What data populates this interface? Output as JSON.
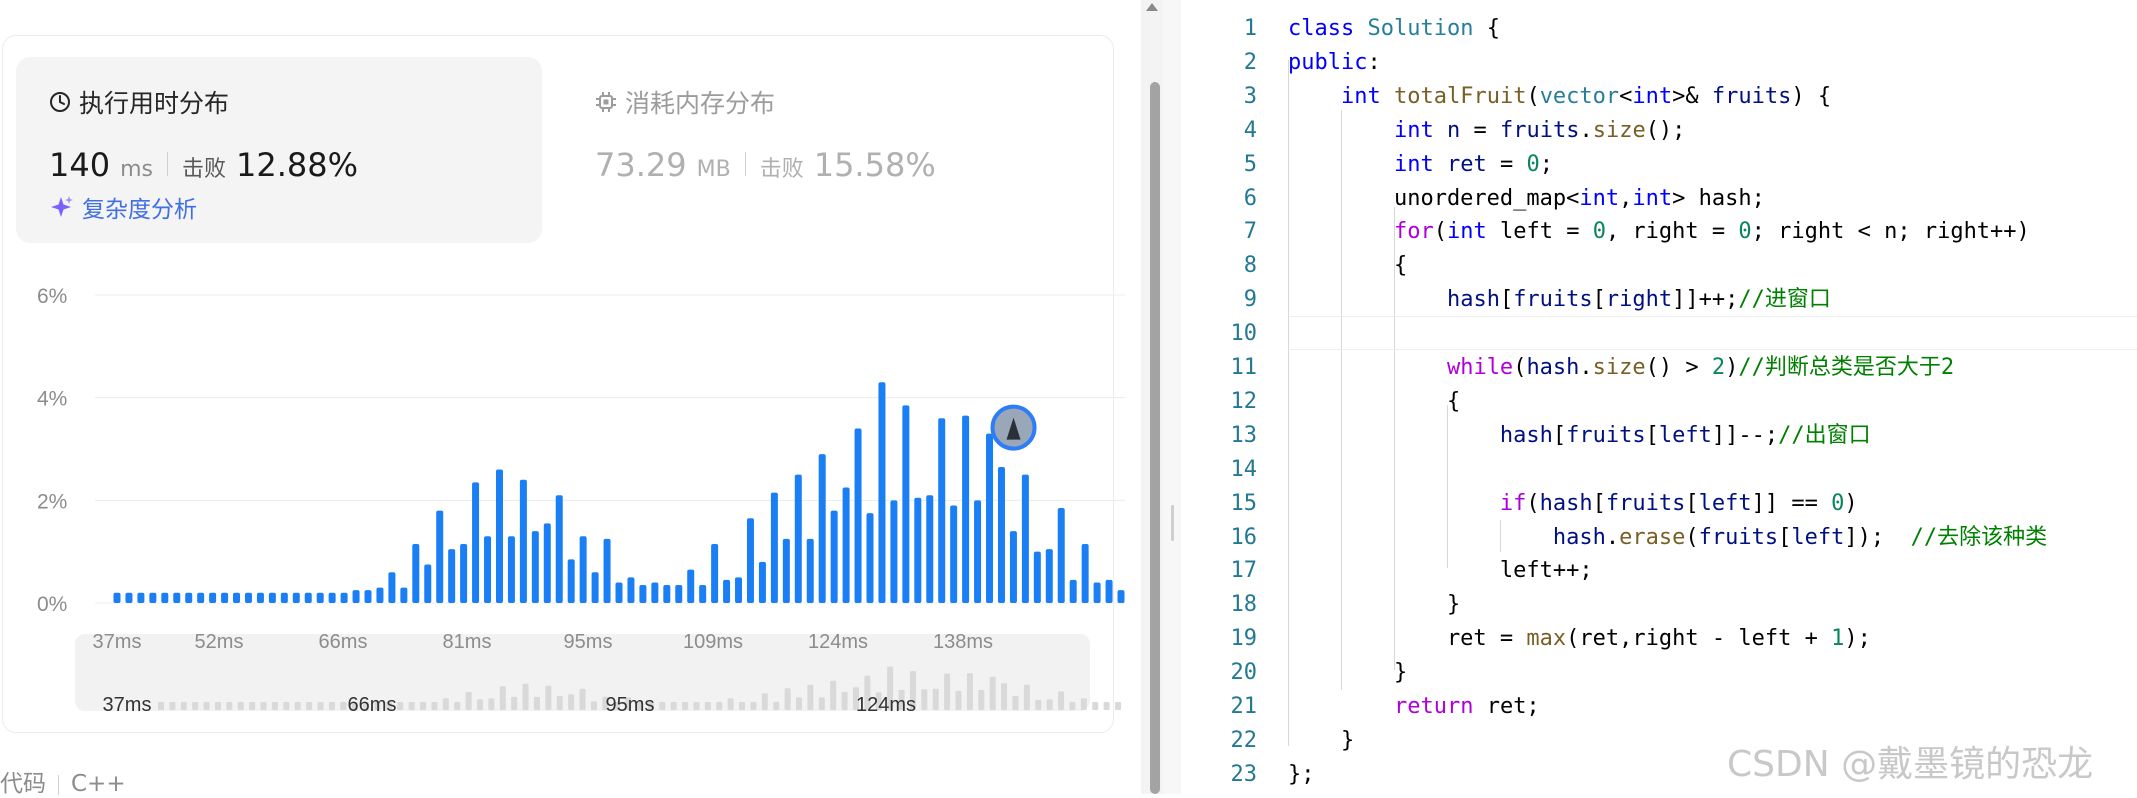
{
  "time_panel": {
    "title": "执行用时分布",
    "value": "140",
    "unit": "ms",
    "beat_label": "击败",
    "beat_value": "12.88%",
    "complexity_link": "复杂度分析"
  },
  "memory_panel": {
    "title": "消耗内存分布",
    "value": "73.29",
    "unit": "MB",
    "beat_label": "击败",
    "beat_value": "15.58%"
  },
  "chart_data": {
    "type": "bar",
    "ylabel": "",
    "y_ticks": [
      "6%",
      "4%",
      "2%",
      "0%"
    ],
    "ylim": [
      0,
      6
    ],
    "x_ticks": [
      "37ms",
      "52ms",
      "66ms",
      "81ms",
      "95ms",
      "109ms",
      "124ms",
      "138ms"
    ],
    "values": [
      0.2,
      0.2,
      0.2,
      0.2,
      0.2,
      0.2,
      0.2,
      0.2,
      0.2,
      0.2,
      0.2,
      0.2,
      0.2,
      0.2,
      0.2,
      0.2,
      0.2,
      0.2,
      0.2,
      0.2,
      0.25,
      0.25,
      0.3,
      0.6,
      0.3,
      1.15,
      0.75,
      1.8,
      1.05,
      1.15,
      2.35,
      1.3,
      2.6,
      1.3,
      2.4,
      1.4,
      1.55,
      2.1,
      0.85,
      1.3,
      0.6,
      1.25,
      0.4,
      0.5,
      0.35,
      0.4,
      0.35,
      0.35,
      0.65,
      0.35,
      1.15,
      0.45,
      0.5,
      1.65,
      0.8,
      2.15,
      1.25,
      2.5,
      1.25,
      2.9,
      1.8,
      2.25,
      3.4,
      1.75,
      4.3,
      2.0,
      3.85,
      2.05,
      2.1,
      3.6,
      1.9,
      3.65,
      2.0,
      3.3,
      2.65,
      1.4,
      2.5,
      1.0,
      1.05,
      1.85,
      0.45,
      1.15,
      0.4,
      0.45,
      0.25
    ],
    "highlight_index": 73,
    "grid": true,
    "minimap_ticks": [
      "37ms",
      "66ms",
      "95ms",
      "124ms"
    ]
  },
  "bottom": {
    "code_label": "代码",
    "language": "C++"
  },
  "code": {
    "lines": [
      [
        [
          "kw",
          "class"
        ],
        [
          "p",
          " "
        ],
        [
          "ty",
          "Solution"
        ],
        [
          "p",
          " {"
        ]
      ],
      [
        [
          "kw",
          "public"
        ],
        [
          "p",
          ":"
        ]
      ],
      [
        [
          "p",
          "    "
        ],
        [
          "kw",
          "int"
        ],
        [
          "p",
          " "
        ],
        [
          "fn",
          "totalFruit"
        ],
        [
          "p",
          "("
        ],
        [
          "ty",
          "vector"
        ],
        [
          "p",
          "<"
        ],
        [
          "kw",
          "int"
        ],
        [
          "p",
          ">& "
        ],
        [
          "var",
          "fruits"
        ],
        [
          "p",
          ") {"
        ]
      ],
      [
        [
          "p",
          "        "
        ],
        [
          "kw",
          "int"
        ],
        [
          "p",
          " "
        ],
        [
          "var",
          "n"
        ],
        [
          "p",
          " = "
        ],
        [
          "var",
          "fruits"
        ],
        [
          "p",
          "."
        ],
        [
          "fn",
          "size"
        ],
        [
          "p",
          "();"
        ]
      ],
      [
        [
          "p",
          "        "
        ],
        [
          "kw",
          "int"
        ],
        [
          "p",
          " "
        ],
        [
          "var",
          "ret"
        ],
        [
          "p",
          " = "
        ],
        [
          "num",
          "0"
        ],
        [
          "p",
          ";"
        ]
      ],
      [
        [
          "p",
          "        unordered_map<"
        ],
        [
          "kw",
          "int"
        ],
        [
          "p",
          ","
        ],
        [
          "kw",
          "int"
        ],
        [
          "p",
          "> hash;"
        ]
      ],
      [
        [
          "p",
          "        "
        ],
        [
          "ctrl",
          "for"
        ],
        [
          "p",
          "("
        ],
        [
          "kw",
          "int"
        ],
        [
          "p",
          " left = "
        ],
        [
          "num",
          "0"
        ],
        [
          "p",
          ", right = "
        ],
        [
          "num",
          "0"
        ],
        [
          "p",
          "; right < n; right++)"
        ]
      ],
      [
        [
          "p",
          "        {"
        ]
      ],
      [
        [
          "p",
          "            "
        ],
        [
          "var",
          "hash"
        ],
        [
          "p",
          "["
        ],
        [
          "var",
          "fruits"
        ],
        [
          "p",
          "["
        ],
        [
          "var",
          "right"
        ],
        [
          "p",
          "]]++;"
        ],
        [
          "cm",
          "//进窗口"
        ]
      ],
      [
        [
          "p",
          ""
        ]
      ],
      [
        [
          "p",
          "            "
        ],
        [
          "ctrl",
          "while"
        ],
        [
          "p",
          "("
        ],
        [
          "var",
          "hash"
        ],
        [
          "p",
          "."
        ],
        [
          "fn",
          "size"
        ],
        [
          "p",
          "() > "
        ],
        [
          "num",
          "2"
        ],
        [
          "p",
          ")"
        ],
        [
          "cm",
          "//判断总类是否大于2"
        ]
      ],
      [
        [
          "p",
          "            {"
        ]
      ],
      [
        [
          "p",
          "                "
        ],
        [
          "var",
          "hash"
        ],
        [
          "p",
          "["
        ],
        [
          "var",
          "fruits"
        ],
        [
          "p",
          "["
        ],
        [
          "var",
          "left"
        ],
        [
          "p",
          "]]--;"
        ],
        [
          "cm",
          "//出窗口"
        ]
      ],
      [
        [
          "p",
          ""
        ]
      ],
      [
        [
          "p",
          "                "
        ],
        [
          "ctrl",
          "if"
        ],
        [
          "p",
          "("
        ],
        [
          "var",
          "hash"
        ],
        [
          "p",
          "["
        ],
        [
          "var",
          "fruits"
        ],
        [
          "p",
          "["
        ],
        [
          "var",
          "left"
        ],
        [
          "p",
          "]] == "
        ],
        [
          "num",
          "0"
        ],
        [
          "p",
          ")"
        ]
      ],
      [
        [
          "p",
          "                    "
        ],
        [
          "var",
          "hash"
        ],
        [
          "p",
          "."
        ],
        [
          "fn",
          "erase"
        ],
        [
          "p",
          "("
        ],
        [
          "var",
          "fruits"
        ],
        [
          "p",
          "["
        ],
        [
          "var",
          "left"
        ],
        [
          "p",
          "]);  "
        ],
        [
          "cm",
          "//去除该种类"
        ]
      ],
      [
        [
          "p",
          "                left++;"
        ]
      ],
      [
        [
          "p",
          "            }"
        ]
      ],
      [
        [
          "p",
          "            ret = "
        ],
        [
          "fn",
          "max"
        ],
        [
          "p",
          "(ret,right - left + "
        ],
        [
          "num",
          "1"
        ],
        [
          "p",
          ");"
        ]
      ],
      [
        [
          "p",
          "        }"
        ]
      ],
      [
        [
          "p",
          "        "
        ],
        [
          "ctrl",
          "return"
        ],
        [
          "p",
          " ret;"
        ]
      ],
      [
        [
          "p",
          "    }"
        ]
      ],
      [
        [
          "p",
          "};"
        ]
      ]
    ]
  },
  "watermark": "CSDN @戴墨镜的恐龙",
  "colors": {
    "bar": "#1a7ef5",
    "bar_minimap": "#d9d9d9",
    "accent_link": "#3f6fe3"
  }
}
